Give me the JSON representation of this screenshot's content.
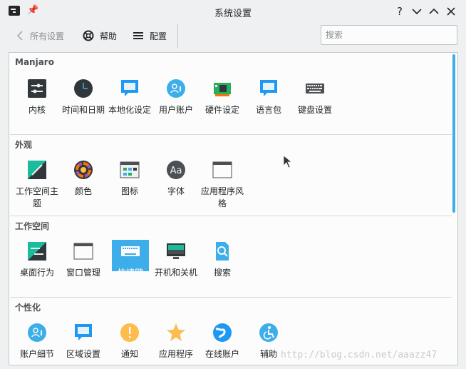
{
  "window": {
    "title": "系统设置"
  },
  "titlebar_buttons": [
    "?",
    "⌄",
    "⌃",
    "✕"
  ],
  "toolbar": {
    "back_label": "所有设置",
    "help_label": "帮助",
    "config_label": "配置"
  },
  "search": {
    "placeholder": "搜索"
  },
  "categories": [
    {
      "title": "Manjaro",
      "items": [
        "内核",
        "时间和日期",
        "本地化设定",
        "用户账户",
        "硬件设定",
        "语言包",
        "键盘设置"
      ]
    },
    {
      "title": "外观",
      "items": [
        "工作空间主题",
        "颜色",
        "图标",
        "字体",
        "应用程序风格"
      ]
    },
    {
      "title": "工作空间",
      "items": [
        "桌面行为",
        "窗口管理",
        "快捷键",
        "开机和关机",
        "搜索"
      ]
    },
    {
      "title": "个性化",
      "items": [
        "账户细节",
        "区域设置",
        "通知",
        "应用程序",
        "在线账户",
        "辅助"
      ]
    }
  ],
  "selected_item": "快捷键",
  "watermark": "http://blog.csdn.net/aaazz47",
  "colors": {
    "accent": "#3daee9",
    "window_bg": "#eff0f1",
    "content_bg": "#fcfcfc"
  }
}
